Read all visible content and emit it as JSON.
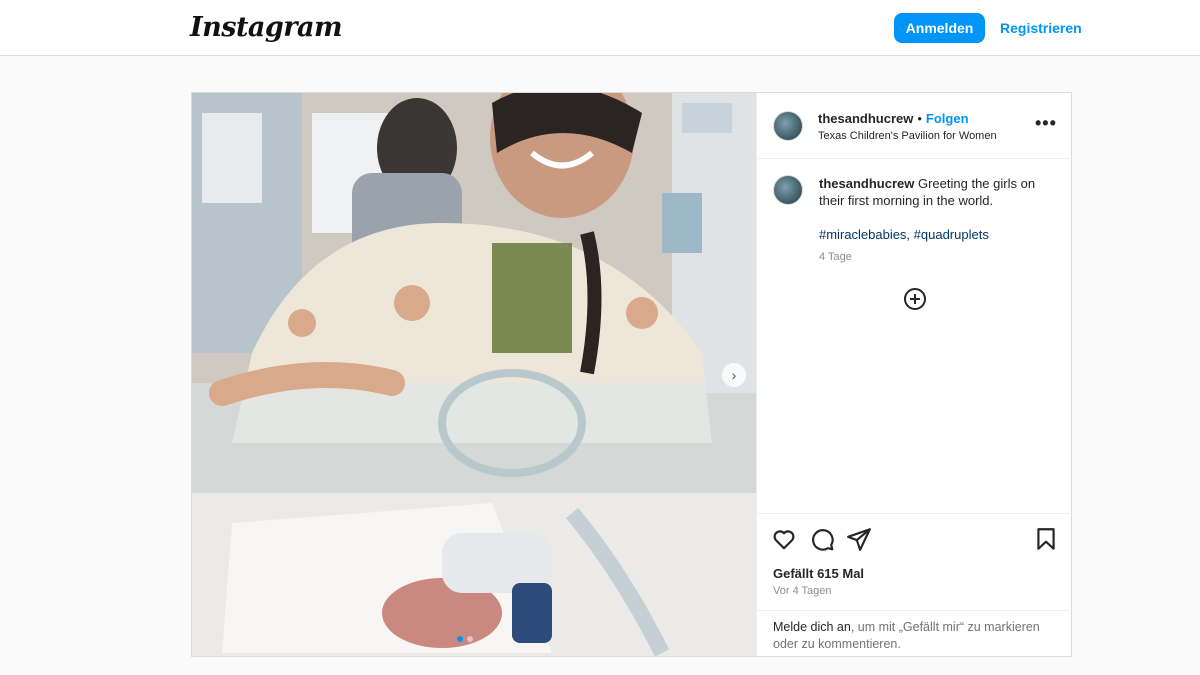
{
  "header": {
    "logo_text": "Instagram",
    "login_label": "Anmelden",
    "register_label": "Registrieren"
  },
  "post": {
    "username": "thesandhucrew",
    "separator": "•",
    "follow_label": "Folgen",
    "location": "Texas Children's Pavilion for Women",
    "more_label": "•••",
    "caption_text": "Greeting the girls on their first morning in the world.",
    "hashtags": "#miraclebabies, #quadruplets",
    "time_small": "4 Tage",
    "likes": "Gefällt 615 Mal",
    "time_ago": "Vor 4 Tagen",
    "login_link": "Melde dich an",
    "login_rest": ", um mit „Gefällt mir“ zu markieren oder zu kommentieren.",
    "carousel_slides": 2,
    "carousel_active_index": 0
  },
  "icons": [
    "heart-icon",
    "comment-icon",
    "share-icon",
    "bookmark-icon",
    "add-circle-icon",
    "chevron-right-icon",
    "more-icon"
  ],
  "colors": {
    "accent": "#0095f6",
    "hashtag": "#00376b",
    "muted": "#8e8e8e",
    "border": "#dbdbdb"
  }
}
